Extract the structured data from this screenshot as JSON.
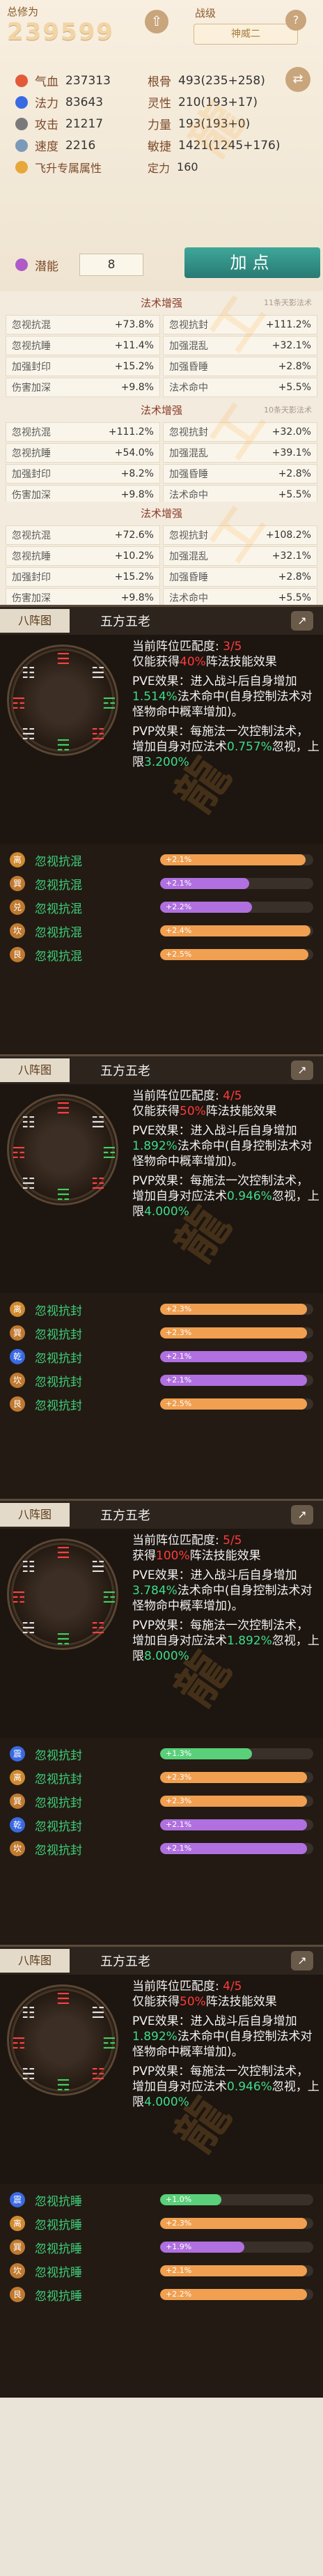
{
  "stats": {
    "xiuwei_label": "总修为",
    "xiuwei_value": "239599",
    "level_label": "战级",
    "level_value": "神威二",
    "rows": [
      [
        {
          "name": "气血",
          "value": "237313",
          "color": "#e25a3a"
        },
        {
          "name": "根骨",
          "value": "493(235+258)",
          "color": ""
        }
      ],
      [
        {
          "name": "法力",
          "value": "83643",
          "color": "#3a6ae2"
        },
        {
          "name": "灵性",
          "value": "210(193+17)",
          "color": ""
        }
      ],
      [
        {
          "name": "攻击",
          "value": "21217",
          "color": "#7a7a7a"
        },
        {
          "name": "力量",
          "value": "193(193+0)",
          "color": ""
        }
      ],
      [
        {
          "name": "速度",
          "value": "2216",
          "color": "#7a9ab8"
        },
        {
          "name": "敏捷",
          "value": "1421(1245+176)",
          "color": ""
        }
      ]
    ],
    "fly_label": "飞升专属属性",
    "fly_attr_name": "定力",
    "fly_attr_value": "160",
    "potential_label": "潜能",
    "potential_value": "8",
    "add_button": "加点"
  },
  "enhance": [
    {
      "title": "法术增强",
      "note": "11条天影法术",
      "rows": [
        [
          {
            "k": "忽视抗混",
            "v": "+73.8%"
          },
          {
            "k": "忽视抗封",
            "v": "+111.2%"
          }
        ],
        [
          {
            "k": "忽视抗睡",
            "v": "+11.4%"
          },
          {
            "k": "加强混乱",
            "v": "+32.1%"
          }
        ],
        [
          {
            "k": "加强封印",
            "v": "+15.2%"
          },
          {
            "k": "加强昏睡",
            "v": "+2.8%"
          }
        ],
        [
          {
            "k": "伤害加深",
            "v": "+9.8%"
          },
          {
            "k": "法术命中",
            "v": "+5.5%"
          }
        ]
      ]
    },
    {
      "title": "法术增强",
      "note": "10条天影法术",
      "rows": [
        [
          {
            "k": "忽视抗混",
            "v": "+111.2%"
          },
          {
            "k": "忽视抗封",
            "v": "+32.0%"
          }
        ],
        [
          {
            "k": "忽视抗睡",
            "v": "+54.0%"
          },
          {
            "k": "加强混乱",
            "v": "+39.1%"
          }
        ],
        [
          {
            "k": "加强封印",
            "v": "+8.2%"
          },
          {
            "k": "加强昏睡",
            "v": "+2.8%"
          }
        ],
        [
          {
            "k": "伤害加深",
            "v": "+9.8%"
          },
          {
            "k": "法术命中",
            "v": "+5.5%"
          }
        ]
      ]
    },
    {
      "title": "法术增强",
      "note": "",
      "rows": [
        [
          {
            "k": "忽视抗混",
            "v": "+72.6%"
          },
          {
            "k": "忽视抗封",
            "v": "+108.2%"
          }
        ],
        [
          {
            "k": "忽视抗睡",
            "v": "+10.2%"
          },
          {
            "k": "加强混乱",
            "v": "+32.1%"
          }
        ],
        [
          {
            "k": "加强封印",
            "v": "+15.2%"
          },
          {
            "k": "加强昏睡",
            "v": "+2.8%"
          }
        ],
        [
          {
            "k": "伤害加深",
            "v": "+9.8%"
          },
          {
            "k": "法术命中",
            "v": "+5.5%"
          }
        ]
      ]
    }
  ],
  "formations": [
    {
      "tab": "八阵图",
      "title": "五方五老",
      "match_prefix": "当前阵位匹配度: ",
      "match_value": "3/5",
      "gain_prefix": "仅能获得",
      "gain_value": "40%",
      "gain_suffix": "阵法技能效果",
      "pve_a": "PVE效果：进入战斗后自身增加",
      "pve_v": "1.514%",
      "pve_b": "法术命中(自身控制法术对怪物命中概率增加)。",
      "pvp_a": "PVP效果：每施法一次控制法术，增加自身对应法术",
      "pvp_v": "0.757%",
      "pvp_b": "忽视，上限",
      "pvp_c": "3.200%",
      "rows": [
        {
          "badge": "离",
          "badge_color": "#d08a30",
          "name": "忽视抗混",
          "bar": "+2.1%",
          "fill": 0.95,
          "bar_color": "#f0a050"
        },
        {
          "badge": "巽",
          "badge_color": "#c07a30",
          "name": "忽视抗混",
          "bar": "+2.1%",
          "fill": 0.58,
          "bar_color": "#b070e0"
        },
        {
          "badge": "兑",
          "badge_color": "#c07a30",
          "name": "忽视抗混",
          "bar": "+2.2%",
          "fill": 0.6,
          "bar_color": "#b070e0"
        },
        {
          "badge": "坎",
          "badge_color": "#c07a30",
          "name": "忽视抗混",
          "bar": "+2.4%",
          "fill": 0.98,
          "bar_color": "#f0a050"
        },
        {
          "badge": "艮",
          "badge_color": "#c07a30",
          "name": "忽视抗混",
          "bar": "+2.5%",
          "fill": 0.97,
          "bar_color": "#f0a050"
        }
      ]
    },
    {
      "tab": "八阵图",
      "title": "五方五老",
      "match_prefix": "当前阵位匹配度: ",
      "match_value": "4/5",
      "gain_prefix": "仅能获得",
      "gain_value": "50%",
      "gain_suffix": "阵法技能效果",
      "pve_a": "PVE效果：进入战斗后自身增加",
      "pve_v": "1.892%",
      "pve_b": "法术命中(自身控制法术对怪物命中概率增加)。",
      "pvp_a": "PVP效果：每施法一次控制法术，增加自身对应法术",
      "pvp_v": "0.946%",
      "pvp_b": "忽视，上限",
      "pvp_c": "4.000%",
      "rows": [
        {
          "badge": "离",
          "badge_color": "#d08a30",
          "name": "忽视抗封",
          "bar": "+2.3%",
          "fill": 0.96,
          "bar_color": "#f0a050"
        },
        {
          "badge": "巽",
          "badge_color": "#c07a30",
          "name": "忽视抗封",
          "bar": "+2.3%",
          "fill": 0.96,
          "bar_color": "#f0a050"
        },
        {
          "badge": "乾",
          "badge_color": "#3a6ae2",
          "name": "忽视抗封",
          "bar": "+2.1%",
          "fill": 0.96,
          "bar_color": "#b070e0"
        },
        {
          "badge": "坎",
          "badge_color": "#c07a30",
          "name": "忽视抗封",
          "bar": "+2.1%",
          "fill": 0.96,
          "bar_color": "#b070e0"
        },
        {
          "badge": "艮",
          "badge_color": "#c07a30",
          "name": "忽视抗封",
          "bar": "+2.5%",
          "fill": 0.96,
          "bar_color": "#f0a050"
        }
      ]
    },
    {
      "tab": "八阵图",
      "title": "五方五老",
      "match_prefix": "当前阵位匹配度: ",
      "match_value": "5/5",
      "gain_prefix": "获得",
      "gain_value": "100%",
      "gain_suffix": "阵法技能效果",
      "pve_a": "PVE效果：进入战斗后自身增加",
      "pve_v": "3.784%",
      "pve_b": "法术命中(自身控制法术对怪物命中概率增加)。",
      "pvp_a": "PVP效果：每施法一次控制法术，增加自身对应法术",
      "pvp_v": "1.892%",
      "pvp_b": "忽视，上限",
      "pvp_c": "8.000%",
      "rows": [
        {
          "badge": "震",
          "badge_color": "#3a6ae2",
          "name": "忽视抗封",
          "bar": "+1.3%",
          "fill": 0.6,
          "bar_color": "#5ad07a"
        },
        {
          "badge": "离",
          "badge_color": "#d08a30",
          "name": "忽视抗封",
          "bar": "+2.3%",
          "fill": 0.96,
          "bar_color": "#f0a050"
        },
        {
          "badge": "巽",
          "badge_color": "#c07a30",
          "name": "忽视抗封",
          "bar": "+2.3%",
          "fill": 0.96,
          "bar_color": "#f0a050"
        },
        {
          "badge": "乾",
          "badge_color": "#3a6ae2",
          "name": "忽视抗封",
          "bar": "+2.1%",
          "fill": 0.96,
          "bar_color": "#b070e0"
        },
        {
          "badge": "坎",
          "badge_color": "#c07a30",
          "name": "忽视抗封",
          "bar": "+2.1%",
          "fill": 0.96,
          "bar_color": "#b070e0"
        }
      ]
    },
    {
      "tab": "八阵图",
      "title": "五方五老",
      "match_prefix": "当前阵位匹配度: ",
      "match_value": "4/5",
      "gain_prefix": "仅能获得",
      "gain_value": "50%",
      "gain_suffix": "阵法技能效果",
      "pve_a": "PVE效果：进入战斗后自身增加",
      "pve_v": "1.892%",
      "pve_b": "法术命中(自身控制法术对怪物命中概率增加)。",
      "pvp_a": "PVP效果：每施法一次控制法术，增加自身对应法术",
      "pvp_v": "0.946%",
      "pvp_b": "忽视，上限",
      "pvp_c": "4.000%",
      "rows": [
        {
          "badge": "震",
          "badge_color": "#3a6ae2",
          "name": "忽视抗睡",
          "bar": "+1.0%",
          "fill": 0.4,
          "bar_color": "#5ad07a"
        },
        {
          "badge": "离",
          "badge_color": "#d08a30",
          "name": "忽视抗睡",
          "bar": "+2.3%",
          "fill": 0.96,
          "bar_color": "#f0a050"
        },
        {
          "badge": "巽",
          "badge_color": "#c07a30",
          "name": "忽视抗睡",
          "bar": "+1.9%",
          "fill": 0.55,
          "bar_color": "#b070e0"
        },
        {
          "badge": "坎",
          "badge_color": "#c07a30",
          "name": "忽视抗睡",
          "bar": "+2.1%",
          "fill": 0.96,
          "bar_color": "#f0a050"
        },
        {
          "badge": "艮",
          "badge_color": "#c07a30",
          "name": "忽视抗睡",
          "bar": "+2.2%",
          "fill": 0.96,
          "bar_color": "#f0a050"
        }
      ]
    }
  ]
}
